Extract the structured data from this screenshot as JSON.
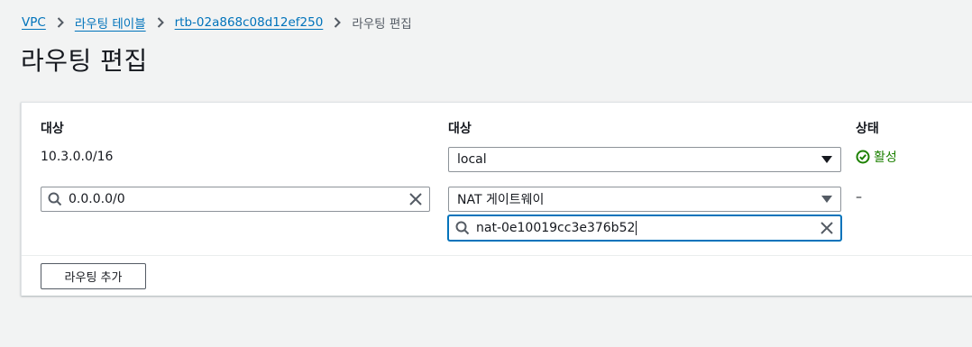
{
  "breadcrumb": {
    "items": [
      {
        "label": "VPC"
      },
      {
        "label": "라우팅 테이블"
      },
      {
        "label": "rtb-02a868c08d12ef250"
      }
    ],
    "current": "라우팅 편집"
  },
  "page": {
    "title": "라우팅 편집"
  },
  "columns": {
    "destination": "대상",
    "target": "대상",
    "status": "상태"
  },
  "routes": [
    {
      "destination": "10.3.0.0/16",
      "target_type": "local",
      "status": "활성"
    },
    {
      "destination": "0.0.0.0/0",
      "target_type": "NAT 게이트웨이",
      "target_id": "nat-0e10019cc3e376b52",
      "status": "–"
    }
  ],
  "buttons": {
    "add_route": "라우팅 추가"
  },
  "colors": {
    "link": "#0073bb",
    "success": "#1d8102",
    "focus": "#0073bb",
    "background": "#f2f3f3"
  },
  "icons": {
    "breadcrumb_separator": "chevron-right-icon",
    "search": "search-icon",
    "clear": "close-icon",
    "dropdown": "caret-down-icon",
    "status_ok": "check-circle-icon"
  }
}
